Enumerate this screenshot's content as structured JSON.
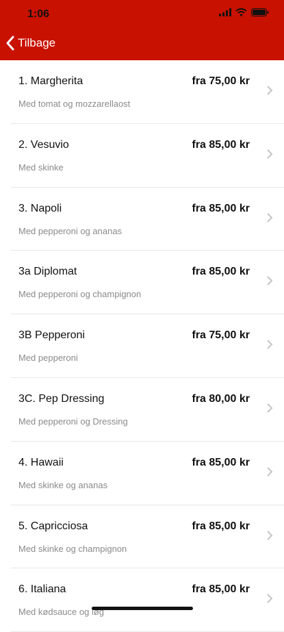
{
  "status_bar": {
    "time": "1:06"
  },
  "nav": {
    "back_label": "Tilbage"
  },
  "colors": {
    "header": "#c91100",
    "price": "#111111",
    "description": "#8a8a8a"
  },
  "menu": [
    {
      "title": "1. Margherita",
      "price": "fra 75,00 kr",
      "description": "Med tomat og mozzarellaost"
    },
    {
      "title": "2. Vesuvio",
      "price": "fra 85,00 kr",
      "description": "Med skinke"
    },
    {
      "title": "3. Napoli",
      "price": "fra 85,00 kr",
      "description": "Med pepperoni og ananas"
    },
    {
      "title": "3a Diplomat",
      "price": "fra 85,00 kr",
      "description": "Med pepperoni og champignon"
    },
    {
      "title": "3B Pepperoni",
      "price": "fra 75,00 kr",
      "description": "Med pepperoni"
    },
    {
      "title": "3C. Pep Dressing",
      "price": "fra 80,00 kr",
      "description": "Med pepperoni og Dressing"
    },
    {
      "title": "4. Hawaii",
      "price": "fra 85,00 kr",
      "description": "Med skinke og ananas"
    },
    {
      "title": "5. Capricciosa",
      "price": "fra 85,00 kr",
      "description": "Med skinke og champignon"
    },
    {
      "title": "6. Italiana",
      "price": "fra 85,00 kr",
      "description": "Med kødsauce og løg"
    }
  ]
}
